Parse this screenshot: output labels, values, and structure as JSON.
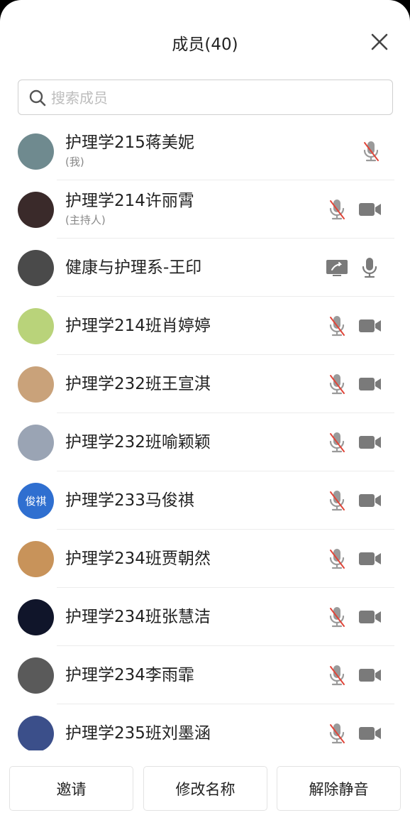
{
  "header": {
    "title": "成员(40)"
  },
  "search": {
    "placeholder": "搜索成员"
  },
  "members": [
    {
      "name": "护理学215蒋美妮",
      "sub": "(我)",
      "mic": "muted",
      "cam": "none",
      "avatar_color": "#6f8a8f"
    },
    {
      "name": "护理学214许丽霄",
      "sub": "(主持人)",
      "mic": "muted",
      "cam": "off",
      "avatar_color": "#3a2a2a"
    },
    {
      "name": "健康与护理系-王印",
      "sub": "",
      "mic": "on",
      "cam": "screen",
      "avatar_color": "#4a4a4a"
    },
    {
      "name": "护理学214班肖婷婷",
      "sub": "",
      "mic": "muted",
      "cam": "off",
      "avatar_color": "#b9d37a"
    },
    {
      "name": "护理学232班王宣淇",
      "sub": "",
      "mic": "muted",
      "cam": "off",
      "avatar_color": "#c9a27a"
    },
    {
      "name": "护理学232班喻颖颖",
      "sub": "",
      "mic": "muted",
      "cam": "off",
      "avatar_color": "#9aa4b4"
    },
    {
      "name": "护理学233马俊祺",
      "sub": "",
      "mic": "muted",
      "cam": "off",
      "avatar_color": "#2f6fd0",
      "avatar_text": "俊祺"
    },
    {
      "name": "护理学234班贾朝然",
      "sub": "",
      "mic": "muted",
      "cam": "off",
      "avatar_color": "#c8935a"
    },
    {
      "name": "护理学234班张慧洁",
      "sub": "",
      "mic": "muted",
      "cam": "off",
      "avatar_color": "#10152a"
    },
    {
      "name": "护理学234李雨霏",
      "sub": "",
      "mic": "muted",
      "cam": "off",
      "avatar_color": "#5a5a5a"
    },
    {
      "name": "护理学235班刘墨涵",
      "sub": "",
      "mic": "muted",
      "cam": "off",
      "avatar_color": "#3b4f8a"
    }
  ],
  "footer": {
    "invite": "邀请",
    "rename": "修改名称",
    "unmute": "解除静音"
  },
  "colors": {
    "mute_red": "#e0463a",
    "icon_gray": "#7a7a7a"
  }
}
